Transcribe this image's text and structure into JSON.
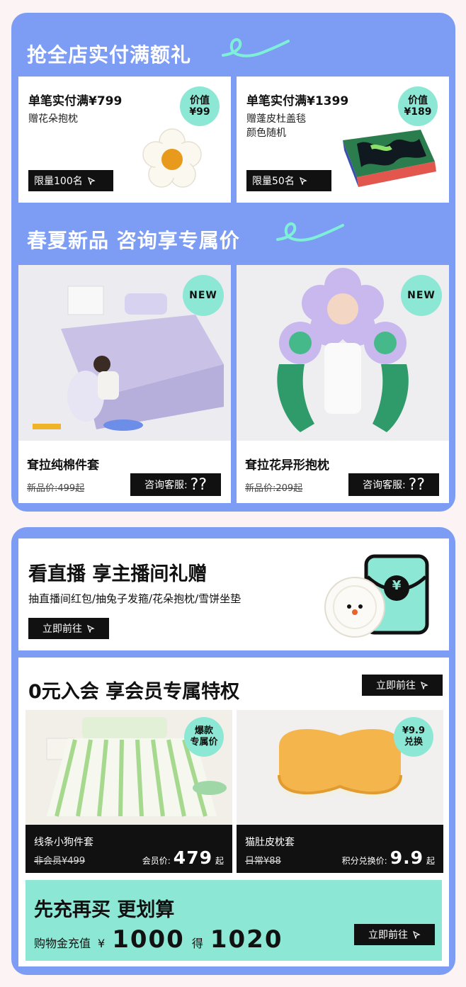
{
  "section1": {
    "title": "抢全店实付满额礼",
    "gifts": [
      {
        "title": "单笔实付满¥799",
        "desc": [
          "赠花朵抱枕"
        ],
        "badge_label": "价值",
        "badge_value": "¥99",
        "limit": "限量100名"
      },
      {
        "title": "单笔实付满¥1399",
        "desc": [
          "赠蓬皮杜盖毯",
          "颜色随机"
        ],
        "badge_label": "价值",
        "badge_value": "¥189",
        "limit": "限量50名"
      }
    ]
  },
  "section2": {
    "title": "春夏新品 咨询享专属价",
    "products": [
      {
        "name": "耷拉纯棉件套",
        "old_price": "新品价:499起",
        "badge": "NEW",
        "consult": "咨询客服:",
        "consult_mark": "??"
      },
      {
        "name": "耷拉花异形抱枕",
        "old_price": "新品价:209起",
        "badge": "NEW",
        "consult": "咨询客服:",
        "consult_mark": "??"
      }
    ]
  },
  "live": {
    "title": "看直播 享主播间礼赠",
    "desc": "抽直播间红包/抽兔子发箍/花朵抱枕/雪饼坐垫",
    "button": "立即前往",
    "envelope_symbol": "¥"
  },
  "member": {
    "title": "0元入会 享会员专属特权",
    "button": "立即前往",
    "products": [
      {
        "name": "线条小狗件套",
        "old_price": "非会员¥499",
        "price_label": "会员价:",
        "price": "479",
        "price_suffix": "起",
        "badge": [
          "爆款",
          "专属价"
        ]
      },
      {
        "name": "猫肚皮枕套",
        "old_price": "日常¥88",
        "price_label": "积分兑换价:",
        "price": "9.9",
        "price_suffix": "起",
        "badge": [
          "¥9.9",
          "兑换"
        ]
      }
    ]
  },
  "recharge": {
    "title": "先充再买 更划算",
    "label": "购物金充值",
    "currency": "¥",
    "amount": "1000",
    "get": "得",
    "result": "1020",
    "button": "立即前往"
  },
  "colors": {
    "panel": "#7d9cf3",
    "mint": "#8ce8d4",
    "black": "#111111"
  }
}
